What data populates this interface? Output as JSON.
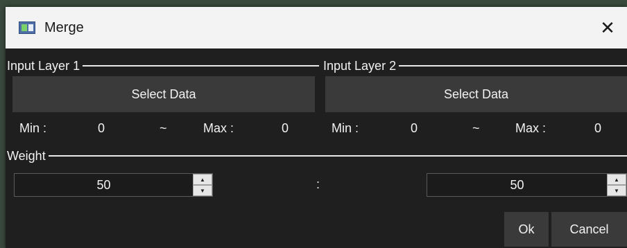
{
  "window": {
    "title": "Merge",
    "close_glyph": "✕",
    "icon": "app-window-icon"
  },
  "groups": {
    "input1": {
      "title": "Input Layer 1",
      "select_label": "Select Data",
      "min_label": "Min :",
      "min_value": "0",
      "tilde": "~",
      "max_label": "Max :",
      "max_value": "0"
    },
    "input2": {
      "title": "Input Layer 2",
      "select_label": "Select Data",
      "min_label": "Min :",
      "min_value": "0",
      "tilde": "~",
      "max_label": "Max :",
      "max_value": "0"
    },
    "weight": {
      "title": "Weight",
      "left_value": "50",
      "separator": ":",
      "right_value": "50",
      "up_glyph": "▲",
      "down_glyph": "▼"
    }
  },
  "buttons": {
    "ok": "Ok",
    "cancel": "Cancel"
  }
}
